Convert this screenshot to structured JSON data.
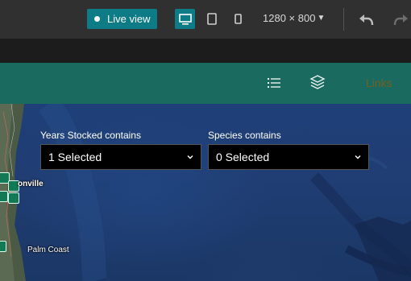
{
  "toolbar": {
    "live_view_label": "Live view",
    "devices": [
      "desktop-icon",
      "tablet-icon",
      "phone-icon"
    ],
    "active_device": "desktop",
    "resolution": "1280 × 800",
    "accent_color": "#0e7c86"
  },
  "app_header": {
    "background_color": "#1b6a60",
    "icons": [
      "list-icon",
      "layers-icon"
    ],
    "links_label": "Links"
  },
  "filters": {
    "years": {
      "label": "Years Stocked contains",
      "value": "1 Selected"
    },
    "species": {
      "label": "Species contains",
      "value": "0 Selected"
    }
  },
  "map": {
    "labels": [
      "onville",
      "Palm Coast"
    ]
  }
}
